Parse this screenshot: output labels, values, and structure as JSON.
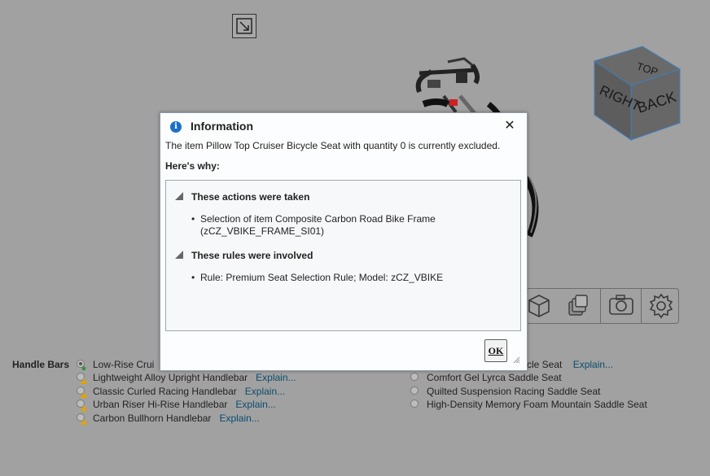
{
  "scene": {
    "cube_faces": {
      "top": "TOP",
      "right": "RIGHT",
      "back": "BACK"
    },
    "toolbar": [
      "cube-view-icon",
      "layers-icon",
      "camera-icon",
      "gear-icon"
    ]
  },
  "options": {
    "handle_bars_label": "Handle Bars",
    "explain_label": "Explain...",
    "handle_bars": [
      {
        "name": "Low-Rise Crui",
        "selected": true,
        "mark": "star",
        "explain": ""
      },
      {
        "name": "Lightweight Alloy Upright Handlebar",
        "selected": false,
        "mark": "warning",
        "explain": "Explain..."
      },
      {
        "name": "Classic Curled Racing Handlebar",
        "selected": false,
        "mark": "warning",
        "explain": "Explain..."
      },
      {
        "name": "Urban Riser Hi-Rise Handlebar",
        "selected": false,
        "mark": "warning",
        "explain": "Explain..."
      },
      {
        "name": "Carbon Bullhorn Handlebar",
        "selected": false,
        "mark": "warning",
        "explain": "Explain..."
      }
    ],
    "seats": [
      {
        "name": "rcle Seat",
        "partial": true,
        "explain": "Explain..."
      },
      {
        "name": "Comfort Gel Lyrca Saddle Seat",
        "explain": ""
      },
      {
        "name": "Quilted Suspension Racing Saddle Seat",
        "explain": ""
      },
      {
        "name": "High-Density Memory Foam Mountain Saddle Seat",
        "explain": ""
      }
    ]
  },
  "dialog": {
    "title": "Information",
    "message": "The item Pillow Top Cruiser Bicycle Seat with quantity 0 is currently excluded.",
    "why_label": "Here's why:",
    "sections": [
      {
        "heading": "These actions were taken",
        "bullets": [
          "Selection of item Composite Carbon Road Bike Frame",
          "(zCZ_VBIKE_FRAME_SI01)"
        ]
      },
      {
        "heading": "These rules were involved",
        "bullets": [
          "Rule: Premium Seat Selection Rule; Model: zCZ_VBIKE"
        ]
      }
    ],
    "ok_label": "OK",
    "close_glyph": "✕"
  },
  "colors": {
    "background": "#a1a1a1",
    "link": "#0b4d6f",
    "info_icon": "#1d6fc7"
  }
}
